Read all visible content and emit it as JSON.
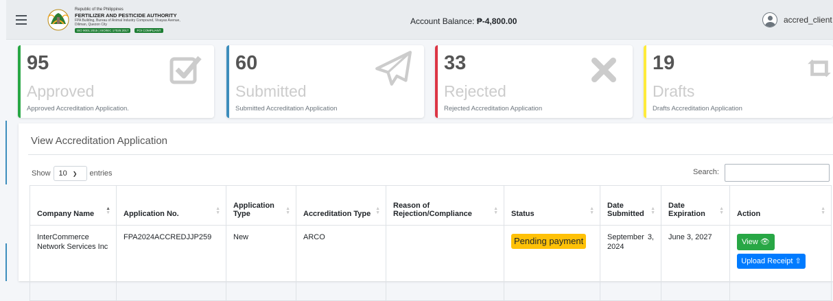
{
  "header": {
    "agency_line1": "Republic of the Philippines",
    "agency_name": "FERTILIZER AND PESTICIDE AUTHORITY",
    "agency_address": "FPA Building, Bureau of Animal Industry Compound, Visayas Avenue, Diliman, Quezon City",
    "badge1": "ISO 9001:2015 | ISO/IEC 17025:2017",
    "badge2": "FOI COMPLIANT",
    "balance_label": "Account Balance:",
    "balance_value": "₱-4,800.00",
    "username": "accred_client"
  },
  "cards": [
    {
      "count": "95",
      "label": "Approved",
      "desc": "Approved Accreditation Application.",
      "icon": "check-square-icon",
      "color": "#28a745"
    },
    {
      "count": "60",
      "label": "Submitted",
      "desc": "Submitted Accreditation Application",
      "icon": "paper-plane-icon",
      "color": "#3c8dbc"
    },
    {
      "count": "33",
      "label": "Rejected",
      "desc": "Rejected Accreditation Application",
      "icon": "times-icon",
      "color": "#dc3545"
    },
    {
      "count": "19",
      "label": "Drafts",
      "desc": "Drafts Accreditation Application",
      "icon": "retweet-icon",
      "color": "#ffeb3b"
    }
  ],
  "panel": {
    "title": "View Accreditation Application",
    "show_label": "Show",
    "entries_value": "10",
    "entries_label": "entries",
    "search_label": "Search:",
    "columns": [
      "Company Name",
      "Application No.",
      "Application Type",
      "Accreditation Type",
      "Reason of Rejection/Compliance",
      "Status",
      "Date Submitted",
      "Date Expiration",
      "Action"
    ],
    "rows": [
      {
        "company": "InterCommerce Network Services Inc",
        "app_no": "FPA2024ACCREDJJP259",
        "app_type": "New",
        "accred_type": "ARCO",
        "reason": "",
        "status": "Pending payment",
        "date_submitted": "September 3, 2024",
        "date_expiration": "June 3, 2027",
        "view_label": "View",
        "upload_label": "Upload Receipt"
      }
    ]
  }
}
